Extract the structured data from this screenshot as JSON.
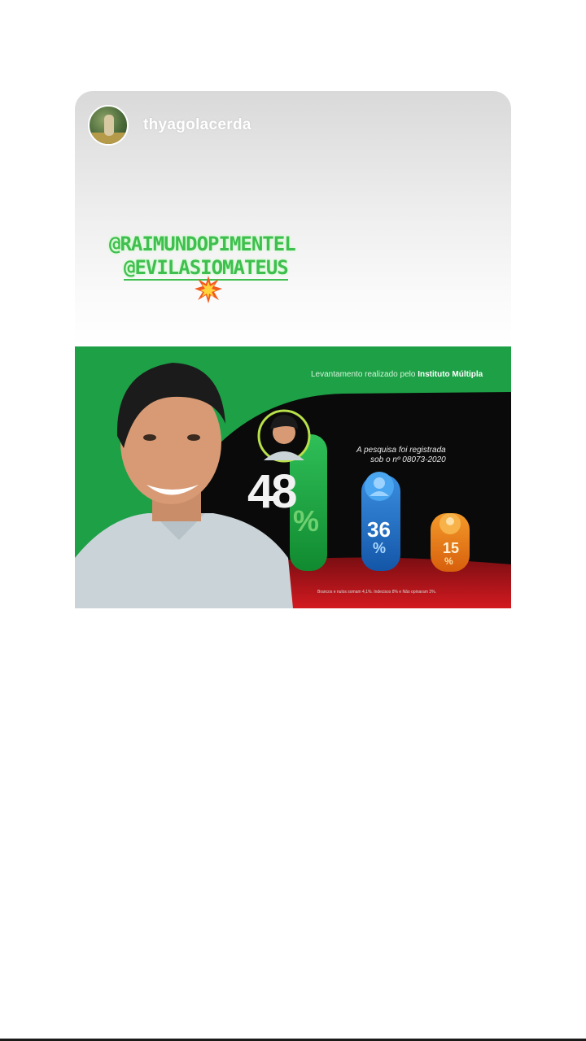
{
  "story": {
    "username": "thyagolacerda",
    "mentions": [
      "@RAIMUNDOPIMENTEL",
      "@EVILASIOMATEUS"
    ],
    "sticker_icon": "explosion-icon"
  },
  "poll_image": {
    "header_prefix": "Levantamento realizado pelo",
    "institute": "Instituto Múltipla",
    "registration_line1": "A pesquisa foi registrada",
    "registration_line2": "sob o nº 08073-2020",
    "candidates": [
      {
        "value": "48",
        "percent_sign": "%",
        "color": "#1e9c3e"
      },
      {
        "value": "36",
        "percent_sign": "%",
        "color": "#2474c8"
      },
      {
        "value": "15",
        "percent_sign": "%",
        "color": "#e87a1a"
      }
    ],
    "footnote": "Brancos e nulos somam 4,1%. Indecisos 8% e Não opinaram 3%."
  },
  "colors": {
    "brand_green": "#1da046",
    "mention_green": "#3fbf4f",
    "dark": "#0a0a0a",
    "red": "#c4141c"
  }
}
